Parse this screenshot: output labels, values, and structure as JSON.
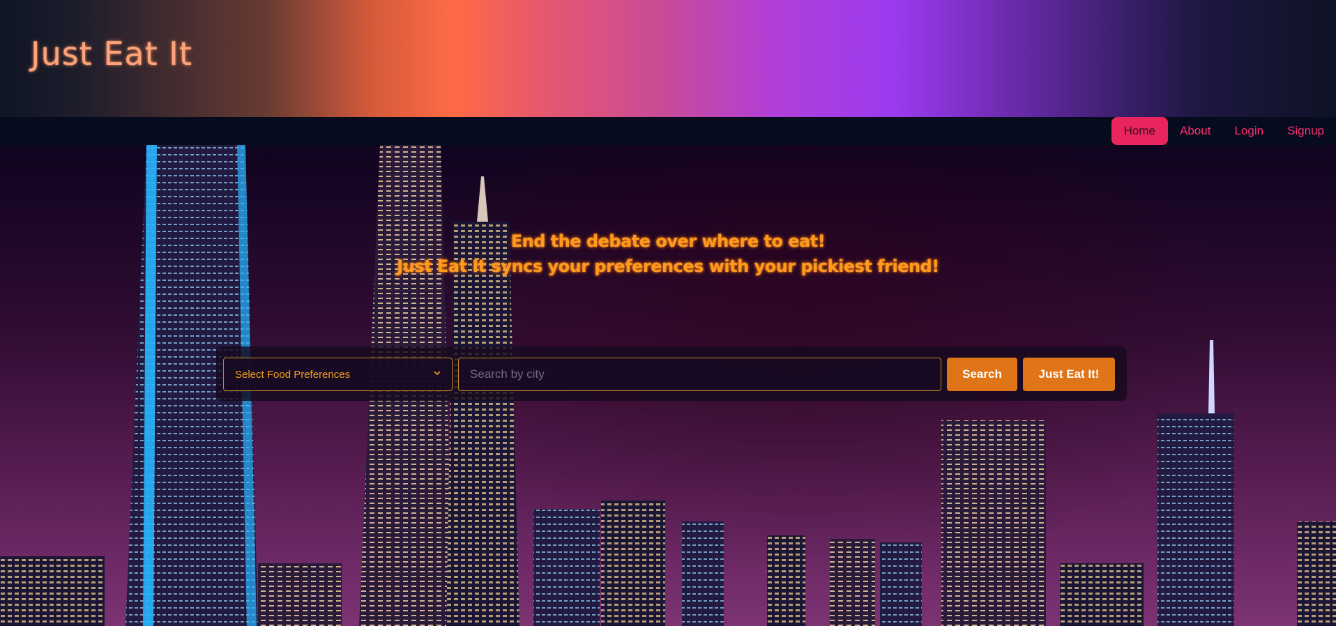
{
  "brand": {
    "title": "Just Eat It"
  },
  "nav": {
    "items": [
      {
        "label": "Home",
        "active": true
      },
      {
        "label": "About",
        "active": false
      },
      {
        "label": "Login",
        "active": false
      },
      {
        "label": "Signup",
        "active": false
      }
    ]
  },
  "hero": {
    "tagline_line1": "End the debate over where to eat!",
    "tagline_line2": "Just Eat It syncs your preferences with your pickiest friend!",
    "background": "night-city-skyline-image"
  },
  "search": {
    "preferences_select": {
      "value": "Select Food Preferences",
      "icon": "chevron-down-icon"
    },
    "city_input": {
      "value": "",
      "placeholder": "Search by city"
    },
    "search_button_label": "Search",
    "just_eat_it_button_label": "Just Eat It!"
  },
  "colors": {
    "accent_pink": "#e9255e",
    "accent_orange": "#e07418",
    "tagline_orange": "#ff9a1e",
    "nav_bg": "#060b1e"
  }
}
